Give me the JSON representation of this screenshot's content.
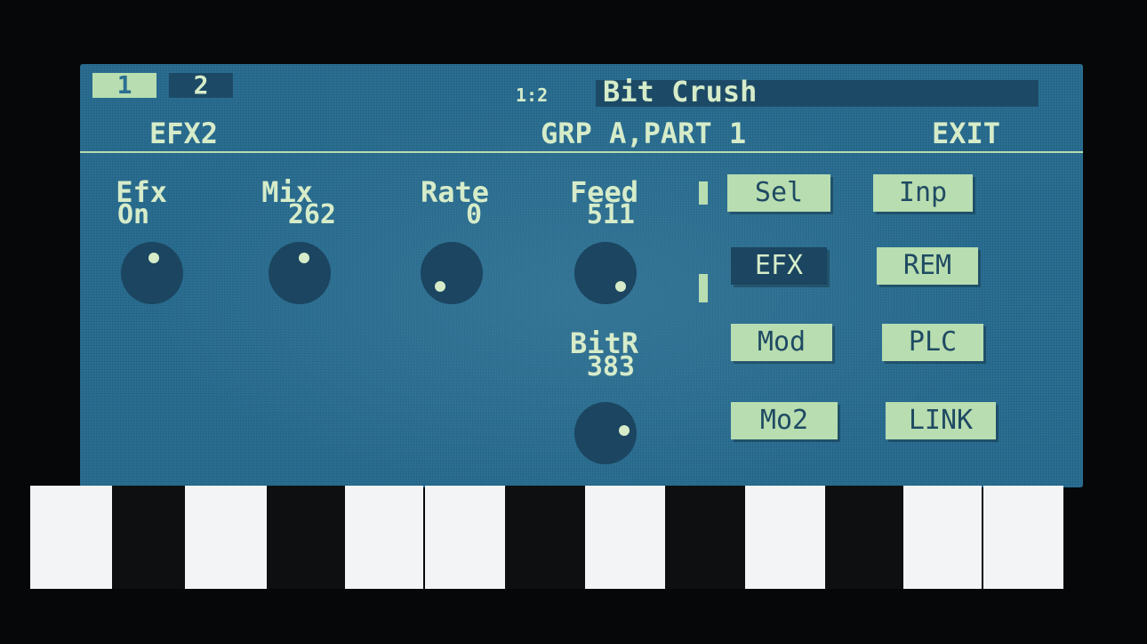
{
  "pages": {
    "tab1": "1",
    "tab2": "2"
  },
  "title": {
    "prefix": "1:2",
    "name": "Bit Crush"
  },
  "header": {
    "left": "EFX2",
    "center": "GRP A,PART 1",
    "exit": "EXIT"
  },
  "params": [
    {
      "name": "Efx",
      "value": "On"
    },
    {
      "name": "Mix",
      "value": "262"
    },
    {
      "name": "Rate",
      "value": "0"
    },
    {
      "name": "Feed",
      "value": "511"
    },
    {
      "name": "BitR",
      "value": "383"
    }
  ],
  "buttons": {
    "sel": "Sel",
    "inp": "Inp",
    "efx": "EFX",
    "rem": "REM",
    "mod": "Mod",
    "plc": "PLC",
    "mo2": "Mo2",
    "link": "LINK"
  },
  "colors": {
    "screen": "#2a6e92",
    "lcd_text": "#d6ecc9",
    "button_fill": "#b8ddb0",
    "knob": "#1b4560",
    "selected_button": "#1b4560"
  },
  "icons": [
    "knob-icon"
  ]
}
